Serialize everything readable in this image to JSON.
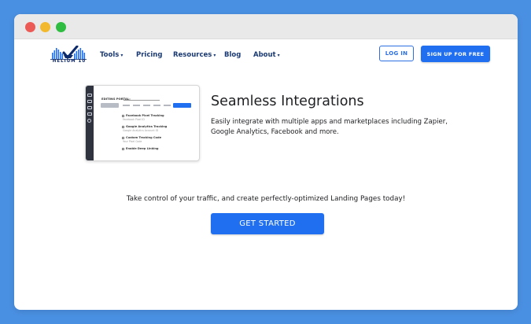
{
  "brand": {
    "logo_text": "HELIUM 10",
    "accent": "#1f6ff0",
    "nav_text_color": "#1b3a73"
  },
  "window_controls": [
    "close",
    "minimize",
    "zoom"
  ],
  "nav": {
    "items": [
      {
        "label": "Tools",
        "dropdown": true
      },
      {
        "label": "Pricing",
        "dropdown": false
      },
      {
        "label": "Resources",
        "dropdown": true
      },
      {
        "label": "Blog",
        "dropdown": false
      },
      {
        "label": "About",
        "dropdown": true
      }
    ],
    "caret": "▾",
    "login_label": "LOG IN",
    "signup_label": "SIGN UP FOR FREE"
  },
  "preview": {
    "editing_label": "EDITING PORTAL:",
    "options": [
      {
        "title": "Facebook Pixel Tracking",
        "sub": "Facebook Pixel ID"
      },
      {
        "title": "Google Analytics Tracking",
        "sub": "Google Analytics Account ID"
      },
      {
        "title": "Custom Tracking Code",
        "sub": "Your Pixel Code"
      },
      {
        "title": "Enable Deep Linking",
        "sub": ""
      }
    ]
  },
  "feature": {
    "title": "Seamless Integrations",
    "description": "Easily integrate with multiple apps and marketplaces including Zapier, Google Analytics, Facebook and more."
  },
  "cta": {
    "tagline": "Take control of your traffic, and create perfectly-optimized Landing Pages today!",
    "button_label": "GET STARTED"
  }
}
